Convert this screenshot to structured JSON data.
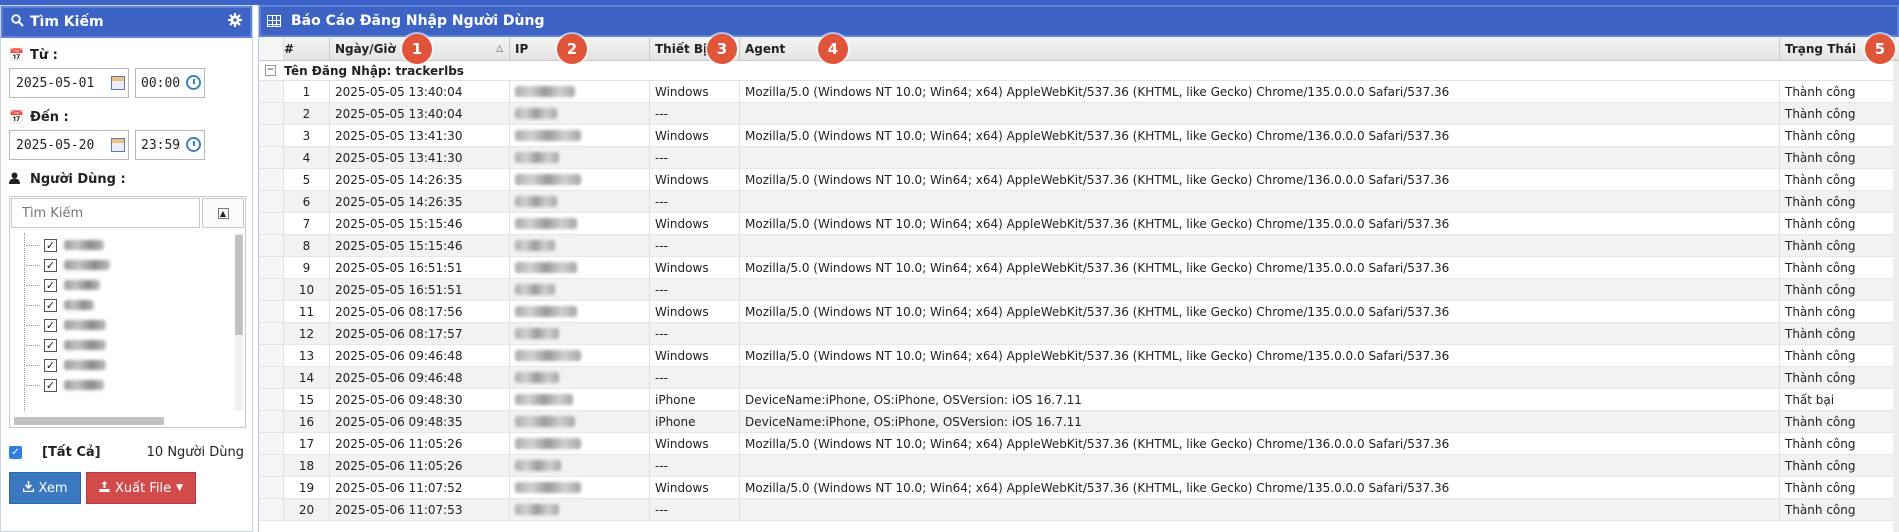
{
  "search_panel": {
    "title": "Tìm Kiếm",
    "from_label": "Từ :",
    "from_date": "2025-05-01",
    "from_time": "00:00",
    "to_label": "Đến :",
    "to_date": "2025-05-20",
    "to_time": "23:59",
    "users_label": "Người Dùng :",
    "search_placeholder": "Tìm Kiếm",
    "all_label": "[Tất Cả]",
    "user_count": "10 Người Dùng",
    "view_button": "Xem",
    "export_button": "Xuất File",
    "icons": [
      "search-icon",
      "gear-icon",
      "calendar-icon",
      "user-icon",
      "download-icon",
      "export-icon",
      "caret-down-icon"
    ]
  },
  "report": {
    "title": "Báo Cáo Đăng Nhập Người Dùng",
    "columns": [
      "#",
      "Ngày/Giờ",
      "IP",
      "Thiết Bị",
      "Agent",
      "Trạng Thái"
    ],
    "badges": [
      "1",
      "2",
      "3",
      "4",
      "5"
    ],
    "group_label": "Tên Đăng Nhập: trackerlbs",
    "rows": [
      {
        "n": "1",
        "dt": "2025-05-05 13:40:04",
        "device": "Windows",
        "agent": "Mozilla/5.0 (Windows NT 10.0; Win64; x64) AppleWebKit/537.36 (KHTML, like Gecko) Chrome/135.0.0.0 Safari/537.36",
        "status": "Thành công"
      },
      {
        "n": "2",
        "dt": "2025-05-05 13:40:04",
        "device": "---",
        "agent": "",
        "status": "Thành công"
      },
      {
        "n": "3",
        "dt": "2025-05-05 13:41:30",
        "device": "Windows",
        "agent": "Mozilla/5.0 (Windows NT 10.0; Win64; x64) AppleWebKit/537.36 (KHTML, like Gecko) Chrome/136.0.0.0 Safari/537.36",
        "status": "Thành công"
      },
      {
        "n": "4",
        "dt": "2025-05-05 13:41:30",
        "device": "---",
        "agent": "",
        "status": "Thành công"
      },
      {
        "n": "5",
        "dt": "2025-05-05 14:26:35",
        "device": "Windows",
        "agent": "Mozilla/5.0 (Windows NT 10.0; Win64; x64) AppleWebKit/537.36 (KHTML, like Gecko) Chrome/136.0.0.0 Safari/537.36",
        "status": "Thành công"
      },
      {
        "n": "6",
        "dt": "2025-05-05 14:26:35",
        "device": "---",
        "agent": "",
        "status": "Thành công"
      },
      {
        "n": "7",
        "dt": "2025-05-05 15:15:46",
        "device": "Windows",
        "agent": "Mozilla/5.0 (Windows NT 10.0; Win64; x64) AppleWebKit/537.36 (KHTML, like Gecko) Chrome/135.0.0.0 Safari/537.36",
        "status": "Thành công"
      },
      {
        "n": "8",
        "dt": "2025-05-05 15:15:46",
        "device": "---",
        "agent": "",
        "status": "Thành công"
      },
      {
        "n": "9",
        "dt": "2025-05-05 16:51:51",
        "device": "Windows",
        "agent": "Mozilla/5.0 (Windows NT 10.0; Win64; x64) AppleWebKit/537.36 (KHTML, like Gecko) Chrome/135.0.0.0 Safari/537.36",
        "status": "Thành công"
      },
      {
        "n": "10",
        "dt": "2025-05-05 16:51:51",
        "device": "---",
        "agent": "",
        "status": "Thành công"
      },
      {
        "n": "11",
        "dt": "2025-05-06 08:17:56",
        "device": "Windows",
        "agent": "Mozilla/5.0 (Windows NT 10.0; Win64; x64) AppleWebKit/537.36 (KHTML, like Gecko) Chrome/135.0.0.0 Safari/537.36",
        "status": "Thành công"
      },
      {
        "n": "12",
        "dt": "2025-05-06 08:17:57",
        "device": "---",
        "agent": "",
        "status": "Thành công"
      },
      {
        "n": "13",
        "dt": "2025-05-06 09:46:48",
        "device": "Windows",
        "agent": "Mozilla/5.0 (Windows NT 10.0; Win64; x64) AppleWebKit/537.36 (KHTML, like Gecko) Chrome/135.0.0.0 Safari/537.36",
        "status": "Thành công"
      },
      {
        "n": "14",
        "dt": "2025-05-06 09:46:48",
        "device": "---",
        "agent": "",
        "status": "Thành công"
      },
      {
        "n": "15",
        "dt": "2025-05-06 09:48:30",
        "device": "iPhone",
        "agent": "DeviceName:iPhone, OS:iPhone, OSVersion: iOS 16.7.11",
        "status": "Thất bại"
      },
      {
        "n": "16",
        "dt": "2025-05-06 09:48:35",
        "device": "iPhone",
        "agent": "DeviceName:iPhone, OS:iPhone, OSVersion: iOS 16.7.11",
        "status": "Thành công"
      },
      {
        "n": "17",
        "dt": "2025-05-06 11:05:26",
        "device": "Windows",
        "agent": "Mozilla/5.0 (Windows NT 10.0; Win64; x64) AppleWebKit/537.36 (KHTML, like Gecko) Chrome/136.0.0.0 Safari/537.36",
        "status": "Thành công"
      },
      {
        "n": "18",
        "dt": "2025-05-06 11:05:26",
        "device": "---",
        "agent": "",
        "status": "Thành công"
      },
      {
        "n": "19",
        "dt": "2025-05-06 11:07:52",
        "device": "Windows",
        "agent": "Mozilla/5.0 (Windows NT 10.0; Win64; x64) AppleWebKit/537.36 (KHTML, like Gecko) Chrome/135.0.0.0 Safari/537.36",
        "status": "Thành công"
      },
      {
        "n": "20",
        "dt": "2025-05-06 11:07:53",
        "device": "---",
        "agent": "",
        "status": "Thành công"
      }
    ]
  },
  "colors": {
    "header_blue": "#3d63c5",
    "badge_orange": "#e0553a",
    "view_btn": "#3a78c0",
    "export_btn": "#d14b4b"
  }
}
